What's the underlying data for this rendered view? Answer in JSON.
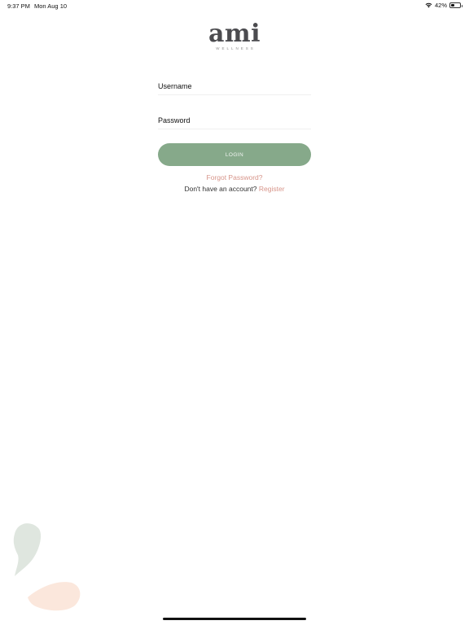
{
  "status": {
    "time": "9:37 PM",
    "date": "Mon Aug 10",
    "battery": "42%",
    "battery_level": 0.42
  },
  "logo": {
    "word": "ami",
    "sub": "WELLNESS"
  },
  "form": {
    "username_label": "Username",
    "password_label": "Password",
    "login_label": "LOGIN",
    "forgot_label": "Forgot Password?",
    "no_account_text": "Don't have an account?",
    "register_label": "Register"
  },
  "colors": {
    "accent_green": "#86a98a",
    "link_coral": "#d7958a",
    "leaf_green": "#dfe6df",
    "leaf_peach": "#fbe7dc"
  }
}
